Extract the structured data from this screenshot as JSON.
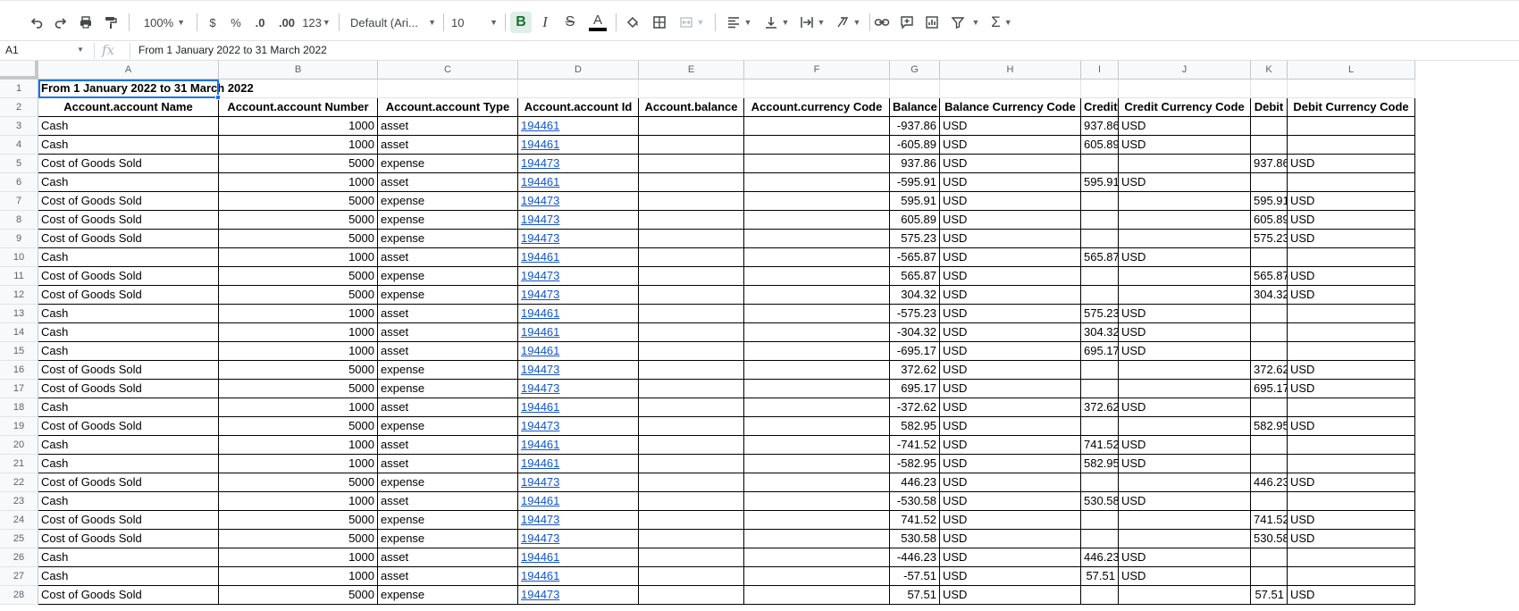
{
  "toolbar": {
    "zoom": "100%",
    "currency": "$",
    "percent": "%",
    "decrease_decimal": ".0",
    "increase_decimal": ".00",
    "more_formats": "123",
    "font": "Default (Ari...",
    "font_size": "10",
    "bold": "B",
    "italic": "I",
    "strikethrough": "S",
    "text_color": "A",
    "functions": "Σ"
  },
  "formula_bar": {
    "name_box": "A1",
    "fx": "fx",
    "content": "From 1 January 2022 to 31 March 2022"
  },
  "columns": [
    "A",
    "B",
    "C",
    "D",
    "E",
    "F",
    "G",
    "H",
    "I",
    "J",
    "K",
    "L"
  ],
  "title": "From 1 January 2022 to 31 March 2022",
  "headers": [
    "Account.account Name",
    "Account.account Number",
    "Account.account Type",
    "Account.account Id",
    "Account.balance",
    "Account.currency Code",
    "Balance",
    "Balance Currency Code",
    "Credit",
    "Credit Currency Code",
    "Debit",
    "Debit Currency Code"
  ],
  "rows": [
    [
      "Cash",
      "1000",
      "asset",
      "194461",
      "",
      "",
      "-937.86",
      "USD",
      "937.86",
      "USD",
      "",
      ""
    ],
    [
      "Cash",
      "1000",
      "asset",
      "194461",
      "",
      "",
      "-605.89",
      "USD",
      "605.89",
      "USD",
      "",
      ""
    ],
    [
      "Cost of Goods Sold",
      "5000",
      "expense",
      "194473",
      "",
      "",
      "937.86",
      "USD",
      "",
      "",
      "937.86",
      "USD"
    ],
    [
      "Cash",
      "1000",
      "asset",
      "194461",
      "",
      "",
      "-595.91",
      "USD",
      "595.91",
      "USD",
      "",
      ""
    ],
    [
      "Cost of Goods Sold",
      "5000",
      "expense",
      "194473",
      "",
      "",
      "595.91",
      "USD",
      "",
      "",
      "595.91",
      "USD"
    ],
    [
      "Cost of Goods Sold",
      "5000",
      "expense",
      "194473",
      "",
      "",
      "605.89",
      "USD",
      "",
      "",
      "605.89",
      "USD"
    ],
    [
      "Cost of Goods Sold",
      "5000",
      "expense",
      "194473",
      "",
      "",
      "575.23",
      "USD",
      "",
      "",
      "575.23",
      "USD"
    ],
    [
      "Cash",
      "1000",
      "asset",
      "194461",
      "",
      "",
      "-565.87",
      "USD",
      "565.87",
      "USD",
      "",
      ""
    ],
    [
      "Cost of Goods Sold",
      "5000",
      "expense",
      "194473",
      "",
      "",
      "565.87",
      "USD",
      "",
      "",
      "565.87",
      "USD"
    ],
    [
      "Cost of Goods Sold",
      "5000",
      "expense",
      "194473",
      "",
      "",
      "304.32",
      "USD",
      "",
      "",
      "304.32",
      "USD"
    ],
    [
      "Cash",
      "1000",
      "asset",
      "194461",
      "",
      "",
      "-575.23",
      "USD",
      "575.23",
      "USD",
      "",
      ""
    ],
    [
      "Cash",
      "1000",
      "asset",
      "194461",
      "",
      "",
      "-304.32",
      "USD",
      "304.32",
      "USD",
      "",
      ""
    ],
    [
      "Cash",
      "1000",
      "asset",
      "194461",
      "",
      "",
      "-695.17",
      "USD",
      "695.17",
      "USD",
      "",
      ""
    ],
    [
      "Cost of Goods Sold",
      "5000",
      "expense",
      "194473",
      "",
      "",
      "372.62",
      "USD",
      "",
      "",
      "372.62",
      "USD"
    ],
    [
      "Cost of Goods Sold",
      "5000",
      "expense",
      "194473",
      "",
      "",
      "695.17",
      "USD",
      "",
      "",
      "695.17",
      "USD"
    ],
    [
      "Cash",
      "1000",
      "asset",
      "194461",
      "",
      "",
      "-372.62",
      "USD",
      "372.62",
      "USD",
      "",
      ""
    ],
    [
      "Cost of Goods Sold",
      "5000",
      "expense",
      "194473",
      "",
      "",
      "582.95",
      "USD",
      "",
      "",
      "582.95",
      "USD"
    ],
    [
      "Cash",
      "1000",
      "asset",
      "194461",
      "",
      "",
      "-741.52",
      "USD",
      "741.52",
      "USD",
      "",
      ""
    ],
    [
      "Cash",
      "1000",
      "asset",
      "194461",
      "",
      "",
      "-582.95",
      "USD",
      "582.95",
      "USD",
      "",
      ""
    ],
    [
      "Cost of Goods Sold",
      "5000",
      "expense",
      "194473",
      "",
      "",
      "446.23",
      "USD",
      "",
      "",
      "446.23",
      "USD"
    ],
    [
      "Cash",
      "1000",
      "asset",
      "194461",
      "",
      "",
      "-530.58",
      "USD",
      "530.58",
      "USD",
      "",
      ""
    ],
    [
      "Cost of Goods Sold",
      "5000",
      "expense",
      "194473",
      "",
      "",
      "741.52",
      "USD",
      "",
      "",
      "741.52",
      "USD"
    ],
    [
      "Cost of Goods Sold",
      "5000",
      "expense",
      "194473",
      "",
      "",
      "530.58",
      "USD",
      "",
      "",
      "530.58",
      "USD"
    ],
    [
      "Cash",
      "1000",
      "asset",
      "194461",
      "",
      "",
      "-446.23",
      "USD",
      "446.23",
      "USD",
      "",
      ""
    ],
    [
      "Cash",
      "1000",
      "asset",
      "194461",
      "",
      "",
      "-57.51",
      "USD",
      "57.51",
      "USD",
      "",
      ""
    ],
    [
      "Cost of Goods Sold",
      "5000",
      "expense",
      "194473",
      "",
      "",
      "57.51",
      "USD",
      "",
      "",
      "57.51",
      "USD"
    ]
  ],
  "colors": {
    "link": "#1155cc",
    "selection": "#1a73e8",
    "bold_active_bg": "#e1ede7"
  }
}
